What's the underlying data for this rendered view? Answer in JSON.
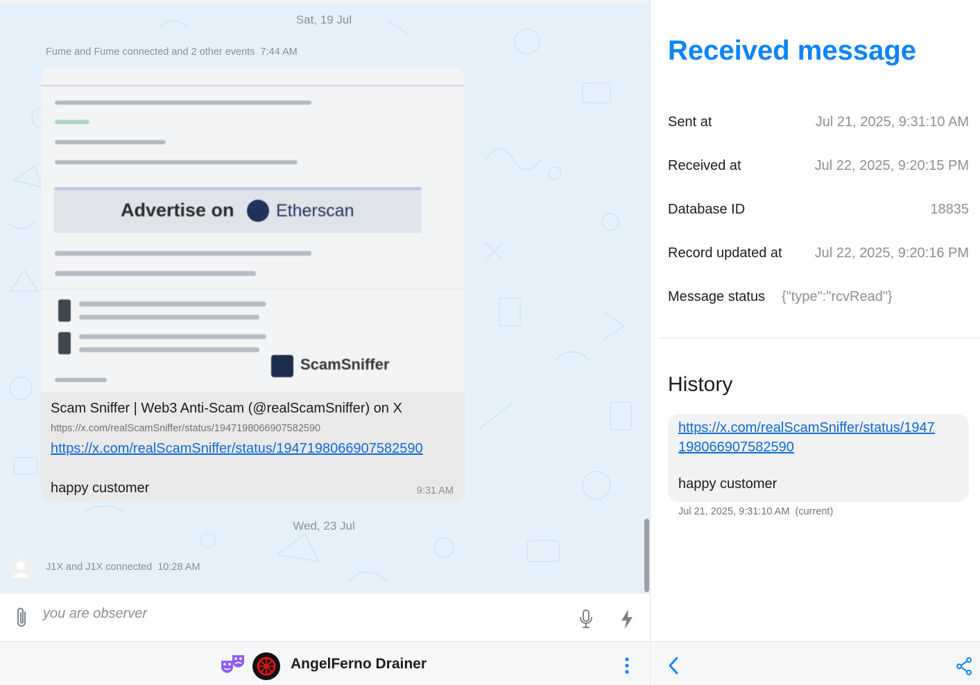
{
  "chat": {
    "date_1": "Sat, 19 Jul",
    "event_1": "Fume and Fume connected and 2 other events",
    "event_1_time": "7:44 AM",
    "message": {
      "preview_ad_text": "Advertise on",
      "preview_ad_brand": "Etherscan",
      "preview_watermark": "ScamSniffer",
      "link_title": "Scam Sniffer | Web3 Anti-Scam (@realScamSniffer) on X",
      "link_url_small": "https://x.com/realScamSniffer/status/1947198066907582590",
      "link_url": "https://x.com/realScamSniffer/status/1947198066907582590",
      "text": "happy customer",
      "time": "9:31 AM"
    },
    "date_2": "Wed, 23 Jul",
    "event_2": "J1X and J1X connected",
    "event_2_time": "10:28 AM"
  },
  "composer": {
    "placeholder": "you are observer",
    "icons": [
      "paperclip-icon",
      "microphone-icon",
      "lightning-icon"
    ]
  },
  "bottom_bar": {
    "contact_name": "AngelFerno Drainer",
    "icons": [
      "incognito-masks-icon",
      "more-vertical-icon",
      "back-chevron-icon",
      "share-icon"
    ]
  },
  "info_panel": {
    "title": "Received message",
    "rows": [
      {
        "label": "Sent at",
        "value": "Jul 21, 2025, 9:31:10 AM"
      },
      {
        "label": "Received at",
        "value": "Jul 22, 2025, 9:20:15 PM"
      },
      {
        "label": "Database ID",
        "value": "18835"
      },
      {
        "label": "Record updated at",
        "value": "Jul 22, 2025, 9:20:16 PM"
      },
      {
        "label": "Message status",
        "value": "{\"type\":\"rcvRead\"}"
      }
    ],
    "history_title": "History",
    "history": {
      "link": "https://x.com/realScamSniffer/status/1947198066907582590",
      "text": "happy customer",
      "timestamp": "Jul 21, 2025, 9:31:10 AM",
      "tag": "(current)"
    }
  },
  "colors": {
    "accent": "#0a84ff",
    "link": "#0a6bd8",
    "chat_bg": "#e4f1fb",
    "mask_icon": "#8b5cf6"
  }
}
